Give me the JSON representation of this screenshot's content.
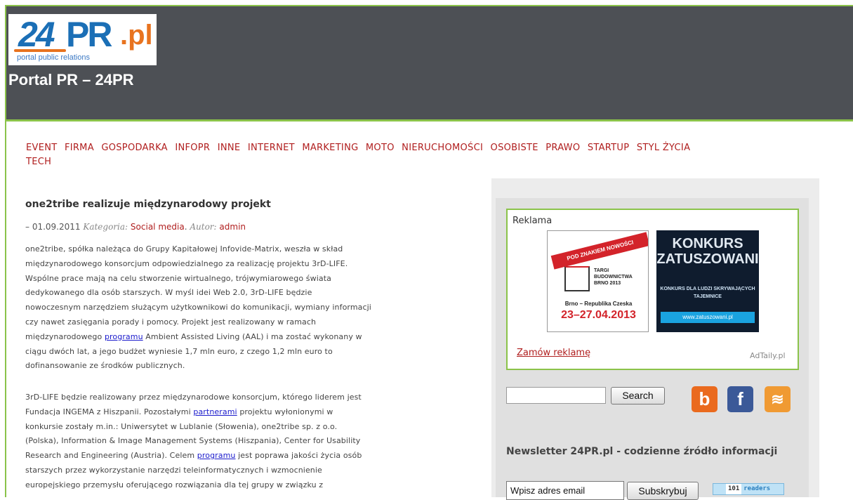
{
  "header": {
    "logo_text": {
      "num": "24",
      "pr": "PR",
      "tld": ".pl",
      "tagline": "portal public relations"
    },
    "site_title": "Portal PR – 24PR"
  },
  "nav": {
    "items": [
      "EVENT",
      "FIRMA",
      "GOSPODARKA",
      "INFOPR",
      "INNE",
      "INTERNET",
      "MARKETING",
      "MOTO",
      "NIERUCHOMOŚCI",
      "OSOBISTE",
      "PRAWO",
      "STARTUP",
      "STYL ŻYCIA",
      "TECH"
    ]
  },
  "post": {
    "title": "one2tribe realizuje międzynarodowy projekt",
    "date_prefix": "– 01.09.2011",
    "category_label": "Kategoria:",
    "category": "Social media",
    "author_label": "Autor:",
    "author": "admin",
    "p1": [
      "one2tribe, spółka należąca do Grupy Kapitałowej Infovide-Matrix, weszła w skład",
      "międzynarodowego konsorcjum odpowiedzialnego za realizację projektu 3rD-LIFE.",
      "Wspólne prace mają na celu stworzenie wirtualnego, trójwymiarowego świata",
      "dedykowanego dla osób starszych. W myśl idei Web 2.0, 3rD-LIFE będzie",
      "nowoczesnym narzędziem służącym użytkownikowi do komunikacji, wymiany informacji",
      "czy nawet zasięgania porady i pomocy. Projekt jest realizowany w ramach"
    ],
    "p1_link_pre": "międzynarodowego",
    "p1_link": "programu",
    "p1_link_post": "Ambient Assisted Living (AAL) i ma zostać wykonany w",
    "p1_tail": [
      "ciągu dwóch lat, a jego budżet wyniesie 1,7 mln euro, z czego 1,2 mln euro to",
      "dofinansowanie ze środków publicznych."
    ],
    "p2_l1": "3rD-LIFE będzie realizowany przez międzynarodowe konsorcjum, którego liderem jest",
    "p2_l2_pre": "Fundacja INGEMA z Hiszpanii. Pozostałymi",
    "p2_l2_link": "partnerami",
    "p2_l2_post": "projektu wyłonionymi w",
    "p2_l3": "konkursie zostały m.in.: Uniwersytet w Lublanie (Słowenia), one2tribe sp. z o.o.",
    "p2_l4": "(Polska), Information & Image Management Systems (Hiszpania), Center for Usability",
    "p2_l5_pre": "Research and Engineering (Austria). Celem",
    "p2_l5_link": "programu",
    "p2_l5_post": "jest poprawa jakości życia osób",
    "p2_l6": "starszych przez wykorzystanie narzędzi teleinformatycznych i wzmocnienie",
    "p2_l7": "europejskiego przemysłu oferującego rozwiązania dla tej grupy w związku z"
  },
  "sidebar": {
    "ad_title": "Reklama",
    "ad1": {
      "ribbon": "POD ZNAKIEM NOWOŚCI",
      "fair": "TARGI BUDOWNICTWA BRNO 2013",
      "city": "Brno – Republika Czeska",
      "date": "23–27.04.2013"
    },
    "ad2": {
      "title": "KONKURS ZATUSZOWANI",
      "sub": "KONKURS DLA LUDZI SKRYWAJĄCYCH TAJEMNICE",
      "url": "www.zatuszowani.pl"
    },
    "order_ad": "Zamów reklamę",
    "adtaily": "AdTaily.pl",
    "search_button": "Search",
    "social": {
      "blip": "b",
      "facebook": "f",
      "rss": "≋"
    },
    "newsletter_title": "Newsletter 24PR.pl - codzienne źródło informacji",
    "email_value": "Wpisz adres email",
    "subscribe_button": "Subskrybuj",
    "readers_count": "101",
    "readers_label": "readers"
  }
}
